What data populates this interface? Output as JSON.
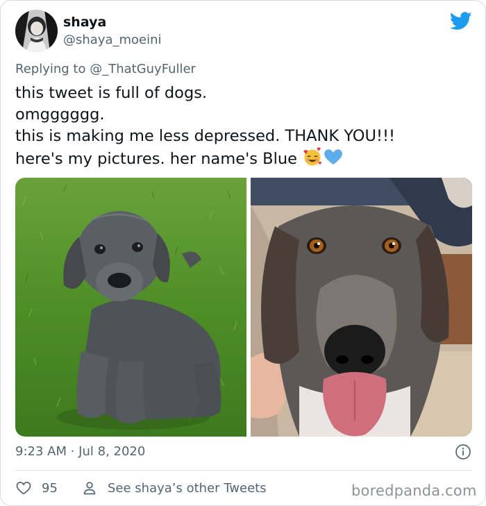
{
  "author": {
    "display_name": "shaya",
    "handle": "@shaya_moeini"
  },
  "reply": {
    "prefix": "Replying to ",
    "mention": "@_ThatGuyFuller"
  },
  "tweet": {
    "lines": [
      "this tweet is full of dogs.",
      "omgggggg.",
      "this is making me less depressed. THANK YOU!!!",
      "here's my pictures. her name's Blue "
    ],
    "emojis": [
      "smiling-face-with-hearts",
      "blue-heart"
    ]
  },
  "meta": {
    "time": "9:23 AM",
    "separator": " · ",
    "date": "Jul 8, 2020"
  },
  "actions": {
    "like_count": "95",
    "other_tweets_label": "See shaya’s other Tweets"
  },
  "watermark": "boredpanda.com",
  "colors": {
    "twitter_blue": "#1d9bf0",
    "secondary_text": "#536471",
    "primary_text": "#0f1419",
    "border": "#d6dde3"
  }
}
